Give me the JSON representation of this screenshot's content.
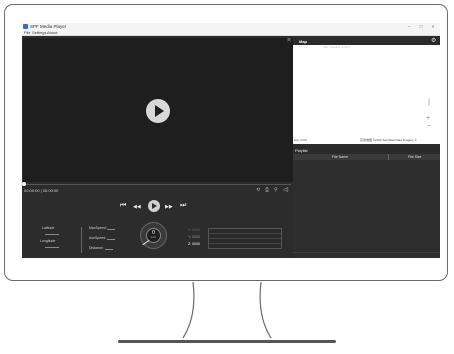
{
  "window": {
    "title": "SPF Media Player",
    "controls": {
      "minimize": "–",
      "maximize": "□",
      "close": "×"
    }
  },
  "menu": {
    "items": [
      "File",
      "Settings",
      "About"
    ]
  },
  "map": {
    "tab_label": "Map",
    "tools_icon": "⤧",
    "gear_icon": "⚙",
    "hint": "Map Satellite Hybrid",
    "zoom_in": "+",
    "zoom_out": "−",
    "credit_left": "Esri  OSM",
    "credit_right": "高德地图 ©2023 AutoNavi  Data  Imagery  ©"
  },
  "playlist": {
    "title": "Playlist",
    "columns": [
      "File Name",
      "File Size"
    ]
  },
  "player": {
    "timecode": "00:00:00 | 00:00:00",
    "progress": 0.0,
    "tool_icons": [
      "⟲",
      "⎙",
      "⚲",
      "◁)"
    ],
    "controls": {
      "prev": "⏮",
      "rewind": "◀◀",
      "forward": "▶▶",
      "next": "⏭"
    }
  },
  "telemetry": {
    "latitude_label": "Latitude",
    "longitude_label": "Longitude",
    "max_speed_label": "MaxSpeed:",
    "ave_speed_label": "AveSpeed:",
    "distance_label": "Distance:",
    "speed_value": "0",
    "speed_unit": "km/h",
    "x_label": "X: 0000",
    "y_label": "Y: 0000",
    "z_label": "Z: 0000"
  },
  "colors": {
    "x_axis": "#6a6a6a",
    "y_axis": "#9a9a9a",
    "z_axis": "#ffffff",
    "accent": "#2d6fd2"
  }
}
